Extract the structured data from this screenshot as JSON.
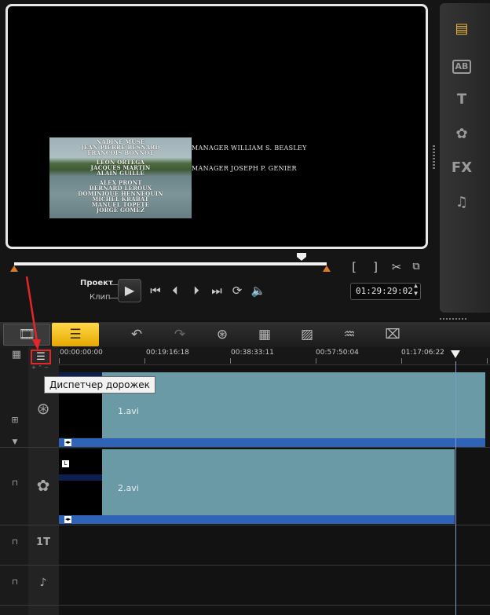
{
  "preview": {
    "credits_in_thumbnail": [
      "NADINE MUSE",
      "JEAN-PIERRE BESNARD",
      "FRANCOIS BONNOT",
      "LEON ORTEGA",
      "JACQUES MARTIN",
      "ALAIN GUILLE",
      "ALEX PRONT",
      "BERNARD LEROUX",
      "DOMINIQUE HENNEQUIN",
      "MICHEL KRABAT",
      "MANUEL TOPETE",
      "JORGE GOMEZ"
    ],
    "credit_line_1": "MANAGER   WILLIAM S. BEASLEY",
    "credit_line_2": "MANAGER   JOSEPH P. GENIER"
  },
  "playback": {
    "mode_project_label": "Проект",
    "mode_clip_label": "Клип",
    "timecode": "01:29:29:02",
    "mark_in": "[",
    "mark_out": "]"
  },
  "library_icons": [
    "media-icon",
    "transitions-icon",
    "title-icon",
    "graphics-icon",
    "filters-icon",
    "audio-icon"
  ],
  "library_labels": {
    "fx": "FX",
    "title": "T"
  },
  "toolbar_icons": [
    "storyboard-view-icon",
    "timeline-view-icon",
    "undo-icon",
    "redo-icon",
    "record-capture-icon",
    "sound-mixer-icon",
    "auto-music-icon",
    "motion-tracking-icon",
    "subtitle-editor-icon"
  ],
  "ruler": {
    "ticks": [
      "00:00:00:00",
      "00:19:16:18",
      "00:38:33:11",
      "00:57:50:04",
      "01:17:06:22"
    ]
  },
  "tooltip": "Диспетчер дорожек",
  "tracks": [
    {
      "name": "video-track",
      "clip": "1.avi"
    },
    {
      "name": "overlay-track",
      "clip": "2.avi"
    },
    {
      "name": "title-track",
      "label": "1T"
    },
    {
      "name": "music-track",
      "clip": ""
    }
  ],
  "colors": {
    "accent_orange": "#e07a20",
    "timeline_button_yellow": "#f5c000",
    "clip_teal": "#6a9aa6",
    "clip_bar_blue": "#2f63b8",
    "highlight_red": "#e3262b"
  }
}
